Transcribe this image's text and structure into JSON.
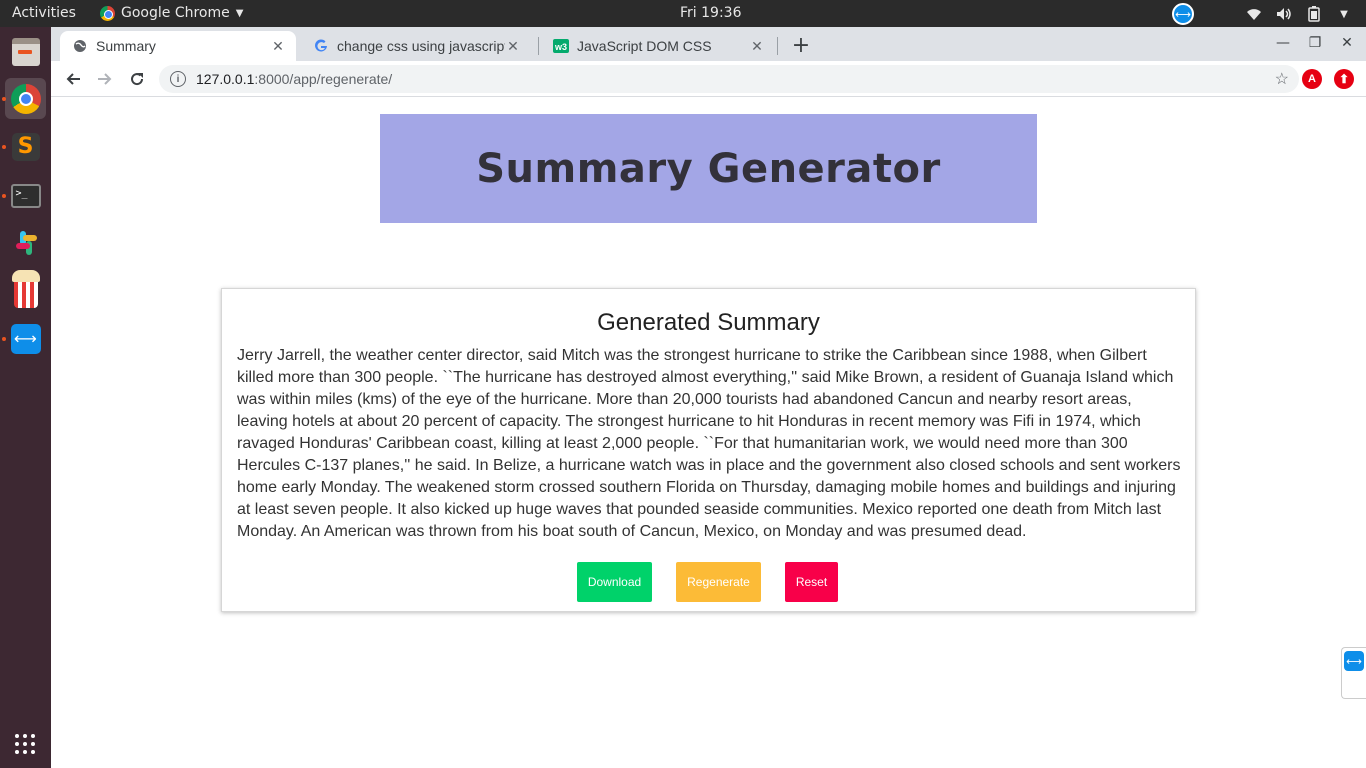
{
  "system": {
    "activities": "Activities",
    "app_menu": "Google Chrome",
    "clock": "Fri 19:36"
  },
  "dock": {
    "items": [
      "files-icon",
      "chrome-icon",
      "sublime-text-icon",
      "terminal-icon",
      "slack-icon",
      "popcorn-time-icon",
      "teamviewer-icon"
    ]
  },
  "browser": {
    "tabs": [
      {
        "title": "Summary",
        "favicon": "globe-icon",
        "active": true
      },
      {
        "title": "change css using javascript",
        "favicon": "google-icon",
        "active": false
      },
      {
        "title": "JavaScript DOM CSS",
        "favicon": "w3schools-icon",
        "active": false
      }
    ],
    "url_host": "127.0.0.1",
    "url_path": ":8000/app/regenerate/"
  },
  "page": {
    "banner_title": "Summary Generator",
    "card_title": "Generated Summary",
    "summary_text": "Jerry Jarrell, the weather center director, said Mitch was the strongest hurricane to strike the Caribbean since 1988, when Gilbert killed more than 300 people. ``The hurricane has destroyed almost everything,'' said Mike Brown, a resident of Guanaja Island which was within miles (kms) of the eye of the hurricane. More than 20,000 tourists had abandoned Cancun and nearby resort areas, leaving hotels at about 20 percent of capacity. The strongest hurricane to hit Honduras in recent memory was Fifi in 1974, which ravaged Honduras' Caribbean coast, killing at least 2,000 people. ``For that humanitarian work, we would need more than 300 Hercules C-137 planes,'' he said. In Belize, a hurricane watch was in place and the government also closed schools and sent workers home early Monday. The weakened storm crossed southern Florida on Thursday, damaging mobile homes and buildings and injuring at least seven people. It also kicked up huge waves that pounded seaside communities. Mexico reported one death from Mitch last Monday. An American was thrown from his boat south of Cancun, Mexico, on Monday and was presumed dead.",
    "buttons": {
      "download": "Download",
      "regenerate": "Regenerate",
      "reset": "Reset"
    }
  },
  "colors": {
    "banner": "#a3a6e6",
    "download": "#00d26a",
    "regenerate": "#fcbb37",
    "reset": "#f80049"
  }
}
